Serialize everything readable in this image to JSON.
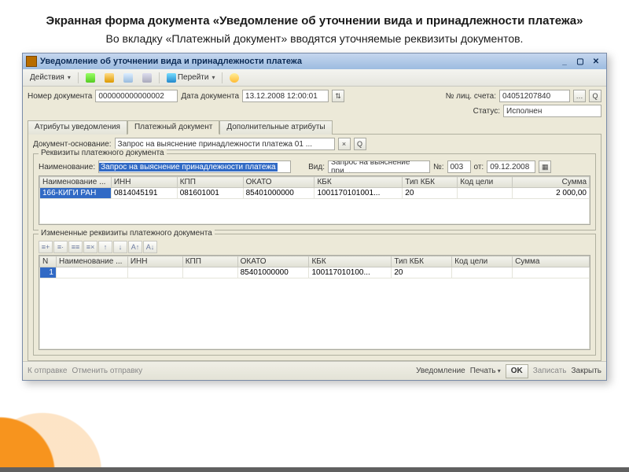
{
  "slide": {
    "title": "Экранная форма документа «Уведомление об уточнении вида и принадлежности платежа»",
    "subtitle": "Во вкладку «Платежный документ»  вводятся уточняемые реквизиты документов."
  },
  "window": {
    "title": "Уведомление об уточнении вида и принадлежности платежа",
    "toolbar": {
      "actions": "Действия",
      "goto": "Перейти"
    },
    "header": {
      "doc_no_label": "Номер документа",
      "doc_no": "000000000000002",
      "doc_date_label": "Дата документа",
      "doc_date": "13.12.2008 12:00:01",
      "pacc_label": "№ лиц. счета:",
      "pacc": "04051207840",
      "status_label": "Статус:",
      "status": "Исполнен"
    },
    "tabs": [
      "Атрибуты уведомления",
      "Платежный документ",
      "Дополнительные атрибуты"
    ],
    "active_tab": 1,
    "tab_panel": {
      "basis_label": "Документ-основание:",
      "basis_value": "Запрос на выяснение принадлежности платежа 01 ...",
      "group1_legend": "Реквизиты платежного документа",
      "name_label": "Наименование:",
      "name_value": "Запрос на выяснение принадлежности платежа",
      "kind_label": "Вид:",
      "kind_value": "Запрос на выяснение при...",
      "num_label": "№:",
      "num_value": "003",
      "from_label": "от:",
      "from_value": "09.12.2008",
      "grid1": {
        "columns": [
          "Наименование ...",
          "ИНН",
          "КПП",
          "ОКАТО",
          "КБК",
          "Тип КБК",
          "Код цели",
          "Сумма"
        ],
        "rows": [
          {
            "name": "166-КИГИ РАН",
            "inn": "0814045191",
            "kpp": "081601001",
            "okato": "85401000000",
            "kbk": "1001170101001...",
            "tipkbk": "20",
            "kod": "",
            "sum": "2 000,00"
          }
        ]
      },
      "group2_legend": "Измененные реквизиты платежного документа",
      "grid2": {
        "columns": [
          "N",
          "Наименование ...",
          "ИНН",
          "КПП",
          "ОКАТО",
          "КБК",
          "Тип КБК",
          "Код цели",
          "Сумма"
        ],
        "rows": [
          {
            "n": "1",
            "name": "",
            "inn": "",
            "kpp": "",
            "okato": "85401000000",
            "kbk": "100117010100...",
            "tipkbk": "20",
            "kod": "",
            "sum": ""
          }
        ]
      }
    },
    "footer": {
      "send": "К отправке",
      "cancel_send": "Отменить отправку",
      "notify": "Уведомление",
      "print": "Печать",
      "ok": "OK",
      "save": "Записать",
      "close": "Закрыть"
    }
  }
}
